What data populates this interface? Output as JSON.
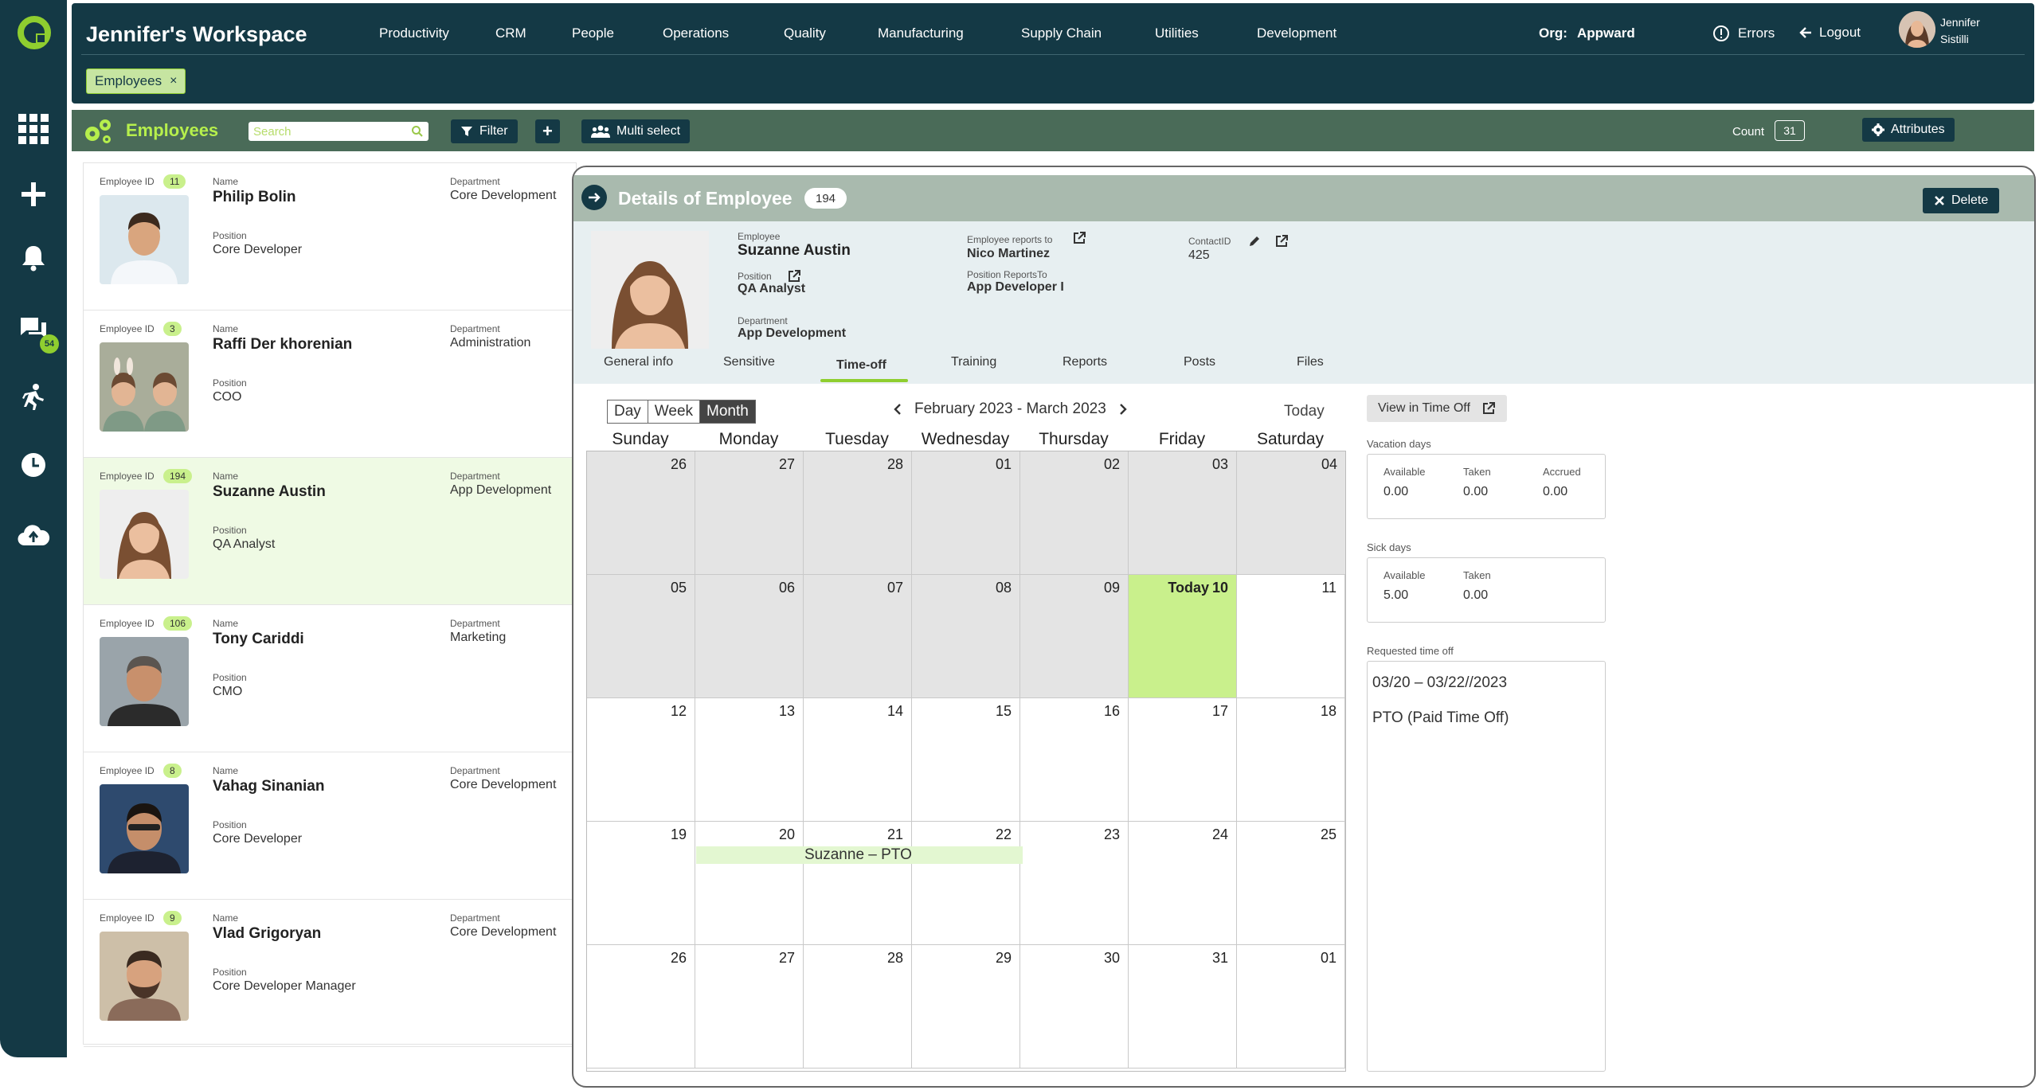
{
  "rail": {
    "icons": [
      "logo-icon",
      "apps-grid-icon",
      "add-icon",
      "bell-icon",
      "chat-icon",
      "run-icon",
      "clock-icon",
      "cloud-upload-icon"
    ],
    "chat_badge": "54"
  },
  "topbar": {
    "title": "Jennifer's Workspace",
    "nav": [
      "Productivity",
      "CRM",
      "People",
      "Operations",
      "Quality",
      "Manufacturing",
      "Supply Chain",
      "Utilities",
      "Development"
    ],
    "org_label": "Org:",
    "org_value": "Appward",
    "errors": "Errors",
    "logout": "Logout",
    "user_name": "Jennifer Sistilli",
    "open_tab": "Employees",
    "open_tab_close": "×"
  },
  "toolbar": {
    "title": "Employees",
    "search_placeholder": "Search",
    "filter": "Filter",
    "add": "+",
    "multi_select": "Multi select",
    "count_label": "Count",
    "count_value": "31",
    "attributes": "Attributes"
  },
  "labels": {
    "employee_id": "Employee ID",
    "name": "Name",
    "department": "Department",
    "position": "Position"
  },
  "employees": [
    {
      "id": "11",
      "name": "Philip Bolin",
      "department": "Core Development",
      "position": "Core Developer"
    },
    {
      "id": "3",
      "name": "Raffi Der khorenian",
      "department": "Administration",
      "position": "COO"
    },
    {
      "id": "194",
      "name": "Suzanne Austin",
      "department": "App Development",
      "position": "QA Analyst"
    },
    {
      "id": "106",
      "name": "Tony Cariddi",
      "department": "Marketing",
      "position": "CMO"
    },
    {
      "id": "8",
      "name": "Vahag Sinanian",
      "department": "Core Development",
      "position": "Core Developer"
    },
    {
      "id": "9",
      "name": "Vlad Grigoryan",
      "department": "Core Development",
      "position": "Core Developer Manager"
    }
  ],
  "details": {
    "title": "Details of Employee",
    "id": "194",
    "delete": "Delete",
    "employee_label": "Employee",
    "employee_value": "Suzanne Austin",
    "position_label": "Position",
    "position_value": "QA Analyst",
    "department_label": "Department",
    "department_value": "App Development",
    "reports_to_label": "Employee reports to",
    "reports_to_value": "Nico Martinez",
    "position_reports_label": "Position ReportsTo",
    "position_reports_value": "App Developer I",
    "contact_label": "ContactID",
    "contact_value": "425",
    "tabs": [
      "General info",
      "Sensitive",
      "Time-off",
      "Training",
      "Reports",
      "Posts",
      "Files"
    ],
    "active_tab": "Time-off"
  },
  "calendar": {
    "views": [
      "Day",
      "Week",
      "Month"
    ],
    "selected_view": "Month",
    "range": "February 2023 - March 2023",
    "today_btn": "Today",
    "weekdays": [
      "Sunday",
      "Monday",
      "Tuesday",
      "Wednesday",
      "Thursday",
      "Friday",
      "Saturday"
    ],
    "weeks": [
      [
        "26",
        "27",
        "28",
        "01",
        "02",
        "03",
        "04"
      ],
      [
        "05",
        "06",
        "07",
        "08",
        "09",
        "10",
        "11"
      ],
      [
        "12",
        "13",
        "14",
        "15",
        "16",
        "17",
        "18"
      ],
      [
        "19",
        "20",
        "21",
        "22",
        "23",
        "24",
        "25"
      ],
      [
        "26",
        "27",
        "28",
        "29",
        "30",
        "31",
        "01"
      ]
    ],
    "today_label": "Today",
    "event": "Suzanne – PTO"
  },
  "timeoff": {
    "view_btn": "View in Time Off",
    "vacation_title": "Vacation days",
    "vacation": {
      "available_label": "Available",
      "available": "0.00",
      "taken_label": "Taken",
      "taken": "0.00",
      "accrued_label": "Accrued",
      "accrued": "0.00"
    },
    "sick_title": "Sick days",
    "sick": {
      "available_label": "Available",
      "available": "5.00",
      "taken_label": "Taken",
      "taken": "0.00"
    },
    "requested_title": "Requested time off",
    "requested_dates": "03/20 – 03/22//2023",
    "requested_type": "PTO (Paid Time Off)"
  },
  "colors": {
    "navy": "#143945",
    "accent_green": "#8fce2f",
    "toolbar_green": "#4a6b58",
    "today_cell": "#c9f08c",
    "details_header": "#a9baae"
  }
}
